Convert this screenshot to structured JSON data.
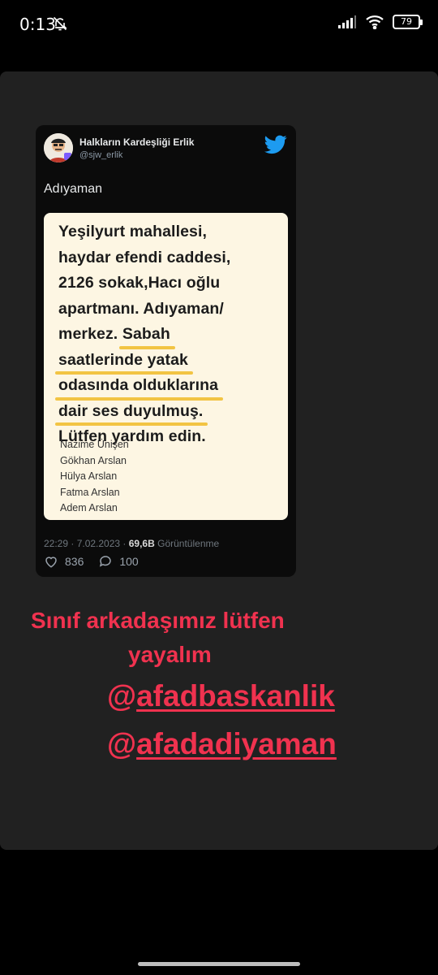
{
  "status_bar": {
    "time": "0:13",
    "battery": "79",
    "icons": [
      "bell-off-icon",
      "signal-icon",
      "wifi-icon",
      "battery-icon"
    ]
  },
  "tweet": {
    "display_name": "Halkların Kardeşliği Erlik",
    "handle": "@sjw_erlik",
    "text": "Adıyaman",
    "note_lines": [
      "Yeşilyurt mahallesi,",
      "haydar efendi caddesi,",
      "2126 sokak,Hacı oğlu",
      "apartmanı.  Adıyaman/"
    ],
    "note_line5_pre": "merkez. ",
    "note_line5_u": "Sabah",
    "note_line6": "saatlerinde yatak",
    "note_line7": "odasında olduklarına",
    "note_line8": "dair ses duyulmuş.",
    "note_line9": "Lütfen yardım edin.",
    "names": [
      "Nazime Ünişen",
      "Gökhan Arslan",
      "Hülya Arslan",
      "Fatma Arslan",
      "Adem Arslan"
    ],
    "timestamp": "22:29 · 7.02.2023 · ",
    "views": "69,6B",
    "views_label": " Görüntülenme",
    "likes": "836",
    "replies": "100"
  },
  "caption": {
    "line1": "Sınıf arkadaşımız lütfen",
    "line2": "yayalım",
    "mention1_at": "@",
    "mention1": "afadbaskanlik",
    "mention2_at": "@",
    "mention2": "afadadiyaman",
    "color": "#f0324f"
  }
}
